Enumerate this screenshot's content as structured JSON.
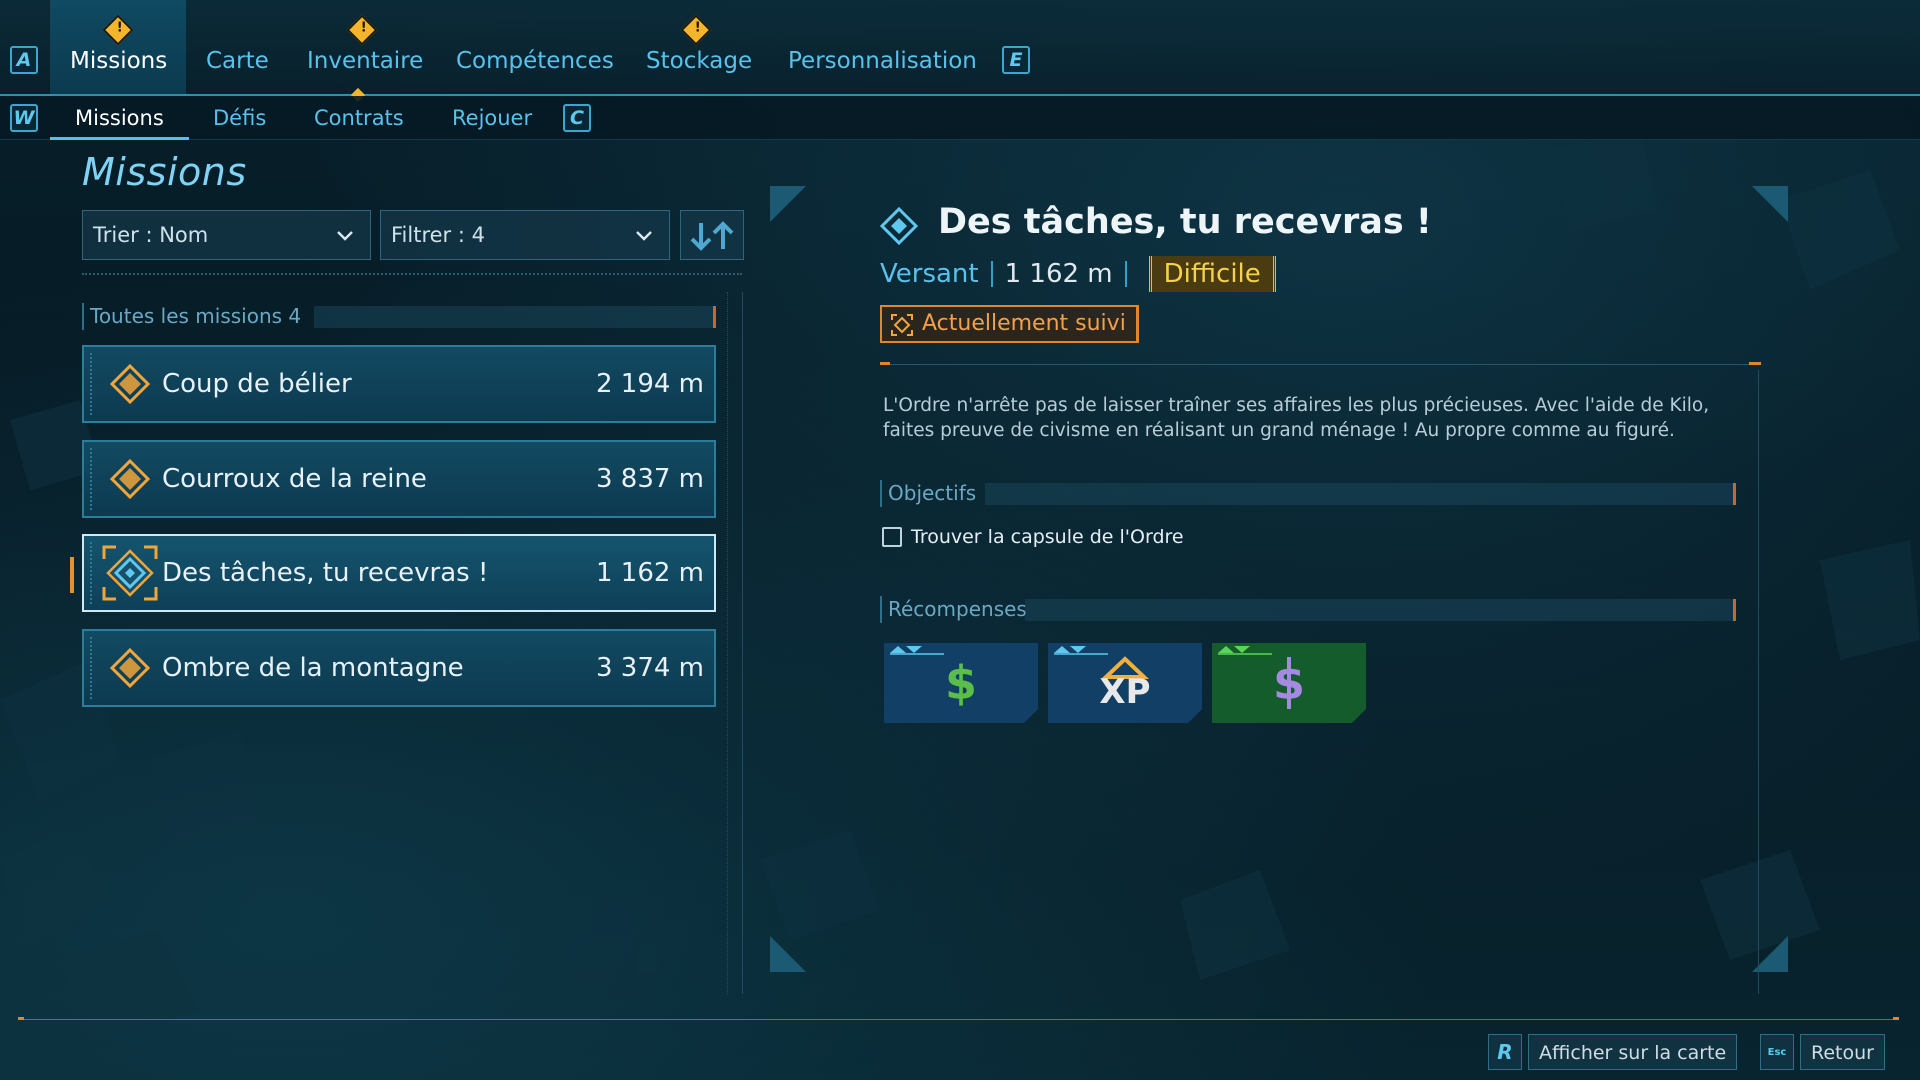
{
  "top_nav": {
    "left_key": "A",
    "right_key": "E",
    "tabs": [
      {
        "label": "Missions",
        "active": true,
        "alert": true
      },
      {
        "label": "Carte",
        "active": false,
        "alert": false
      },
      {
        "label": "Inventaire",
        "active": false,
        "alert": true
      },
      {
        "label": "Compétences",
        "active": false,
        "alert": false
      },
      {
        "label": "Stockage",
        "active": false,
        "alert": true
      },
      {
        "label": "Personnalisation",
        "active": false,
        "alert": false
      }
    ]
  },
  "sub_nav": {
    "left_key": "W",
    "right_key": "C",
    "tabs": [
      {
        "label": "Missions",
        "active": true
      },
      {
        "label": "Défis",
        "active": false
      },
      {
        "label": "Contrats",
        "active": false
      },
      {
        "label": "Rejouer",
        "active": false
      }
    ]
  },
  "left_panel": {
    "title": "Missions",
    "sort_dropdown": "Trier : Nom",
    "filter_dropdown": "Filtrer : 4",
    "group_label": "Toutes les missions 4",
    "missions": [
      {
        "name": "Coup de bélier",
        "distance": "2 194 m",
        "selected": false
      },
      {
        "name": "Courroux de la reine",
        "distance": "3 837 m",
        "selected": false
      },
      {
        "name": "Des tâches, tu recevras !",
        "distance": "1 162 m",
        "selected": true
      },
      {
        "name": "Ombre de la montagne",
        "distance": "3 374 m",
        "selected": false
      }
    ]
  },
  "detail": {
    "title": "Des tâches, tu recevras !",
    "region": "Versant",
    "distance": "1 162 m",
    "difficulty": "Difficile",
    "tracked_label": "Actuellement suivi",
    "description": "L'Ordre n'arrête pas de laisser traîner ses affaires les plus précieuses. Avec l'aide de Kilo, faites preuve de civisme en réalisant un grand ménage ! Au propre comme au figuré.",
    "objectives_label": "Objectifs",
    "objectives": [
      "Trouver la capsule de l'Ordre"
    ],
    "rewards_label": "Récompenses",
    "rewards": [
      {
        "icon": "dollar-icon",
        "color": "#5bbd4a",
        "bg": "#123f66"
      },
      {
        "icon": "xp-icon",
        "color": "#e8e8e8",
        "bg": "#123f66"
      },
      {
        "icon": "currency-icon",
        "color": "#a58be0",
        "bg": "#155c2d"
      }
    ]
  },
  "footer": {
    "map_key": "R",
    "map_label": "Afficher sur la carte",
    "back_key": "Esc",
    "back_label": "Retour"
  },
  "colors": {
    "accent": "#4fc3ec",
    "warning": "#f3b52b",
    "tracked": "#e0872e",
    "difficulty": "#f6d24a"
  }
}
